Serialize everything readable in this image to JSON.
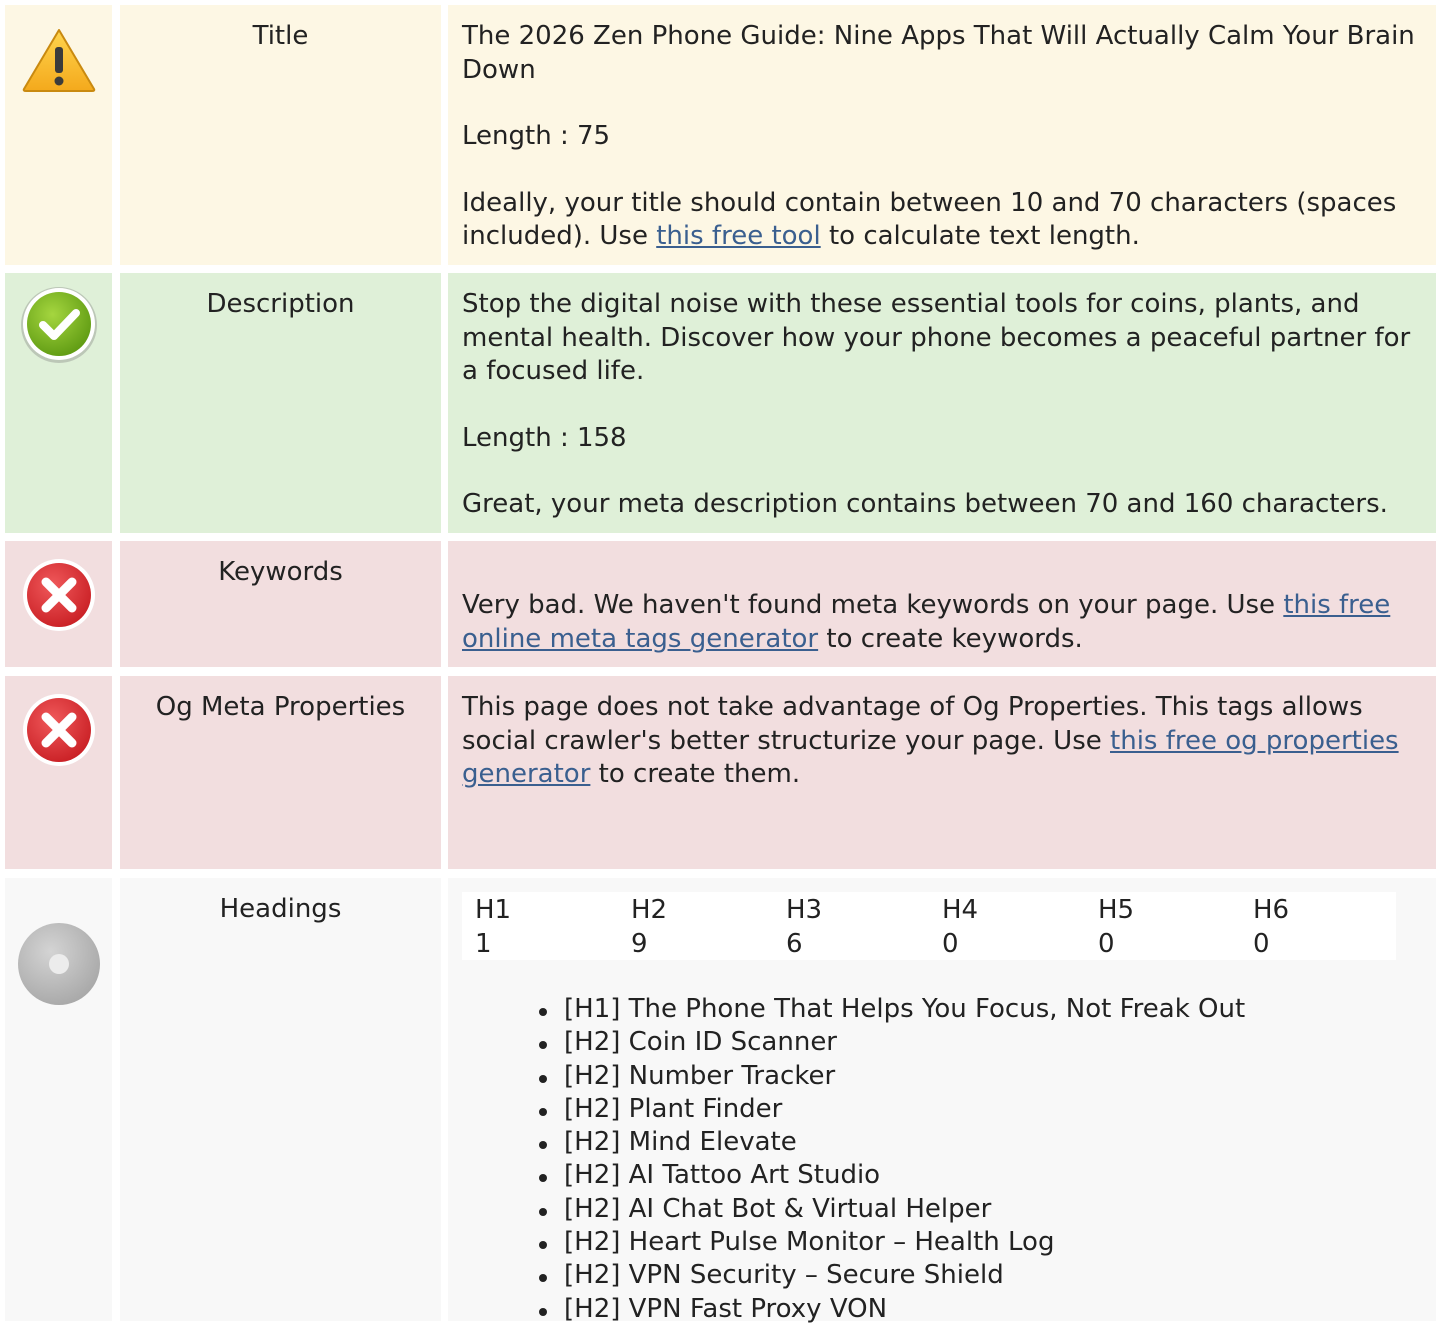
{
  "title_row": {
    "label": "Title",
    "status_icon": "warning-icon",
    "value": "The 2026 Zen Phone Guide: Nine Apps That Will Actually Calm Your Brain Down",
    "length_text": "Length : 75",
    "advice_before": "Ideally, your title should contain between 10 and 70 characters (spaces included). Use ",
    "advice_link": "this free tool",
    "advice_after": " to calculate text length."
  },
  "description_row": {
    "label": "Description",
    "status_icon": "check-icon",
    "value": "Stop the digital noise with these essential tools for coins, plants, and mental health. Discover how your phone becomes a peaceful partner for a focused life.",
    "length_text": "Length : 158",
    "advice": "Great, your meta description contains between 70 and 160 characters."
  },
  "keywords_row": {
    "label": "Keywords",
    "status_icon": "error-icon",
    "advice_before": "Very bad. We haven't found meta keywords on your page. Use ",
    "advice_link": "this free online meta tags generator",
    "advice_after": " to create keywords."
  },
  "og_row": {
    "label": "Og Meta Properties",
    "status_icon": "error-icon",
    "advice_before": "This page does not take advantage of Og Properties. This tags allows social crawler's better structurize your page. Use ",
    "advice_link": "this free og properties generator",
    "advice_after": " to create them."
  },
  "headings_row": {
    "label": "Headings",
    "status_icon": "info-disc-icon",
    "counts": [
      {
        "tag": "H1",
        "count": "1"
      },
      {
        "tag": "H2",
        "count": "9"
      },
      {
        "tag": "H3",
        "count": "6"
      },
      {
        "tag": "H4",
        "count": "0"
      },
      {
        "tag": "H5",
        "count": "0"
      },
      {
        "tag": "H6",
        "count": "0"
      }
    ],
    "items": [
      "[H1] The Phone That Helps You Focus, Not Freak Out",
      "[H2] Coin ID Scanner",
      "[H2] Number Tracker",
      "[H2] Plant Finder",
      "[H2] Mind Elevate",
      "[H2] AI Tattoo Art Studio",
      "[H2] AI Chat Bot & Virtual Helper",
      "[H2] Heart Pulse Monitor – Health Log",
      "[H2] VPN Security – Secure Shield",
      "[H2] VPN Fast Proxy VON"
    ]
  },
  "colors": {
    "warning_bg": "#fdf7e4",
    "good_bg": "#dff0d8",
    "bad_bg": "#f2dedf",
    "neutral_bg": "#f8f8f8",
    "link": "#3a5f8f"
  }
}
